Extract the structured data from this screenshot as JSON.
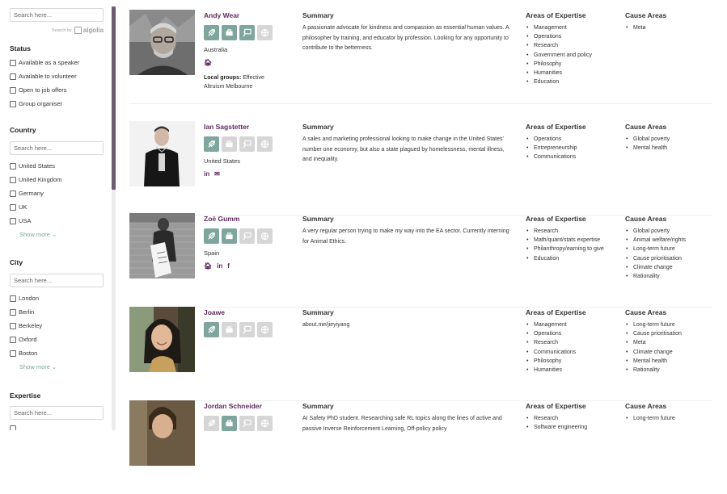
{
  "sidebar": {
    "search_placeholder": "Search here...",
    "search_by": "Search by",
    "algolia": "algolia",
    "status": {
      "heading": "Status",
      "options": [
        "Available as a speaker",
        "Available to volunteer",
        "Open to job offers",
        "Group organiser"
      ]
    },
    "country": {
      "heading": "Country",
      "placeholder": "Search here...",
      "options": [
        "United States",
        "United Kingdom",
        "Germany",
        "UK",
        "USA"
      ],
      "show_more": "Show more"
    },
    "city": {
      "heading": "City",
      "placeholder": "Search here...",
      "options": [
        "London",
        "Berlin",
        "Berkeley",
        "Oxford",
        "Boston"
      ],
      "show_more": "Show more"
    },
    "expertise": {
      "heading": "Expertise",
      "placeholder": "Search here..."
    }
  },
  "headings": {
    "summary": "Summary",
    "expertise": "Areas of Expertise",
    "causes": "Cause Areas"
  },
  "profiles": [
    {
      "name": "Andy Wear",
      "country": "Australia",
      "summary": "A passionate advocate for kindness and compassion as essential human values. A philosopher by training, and educator by profession. Looking for any opportunity to contribute to the betterness.",
      "local_groups_label": "Local groups:",
      "local_groups": "Effective Altruism Melbourne",
      "expertise": [
        "Management",
        "Operations",
        "Research",
        "Government and policy",
        "Philosophy",
        "Humanities",
        "Education"
      ],
      "causes": [
        "Meta"
      ]
    },
    {
      "name": "Ian Sagstetter",
      "country": "United States",
      "summary": "A sales and marketing professional looking to make change in the United States' number one economy, but also a state plagued by homelessness, mental illness, and inequality.",
      "expertise": [
        "Operations",
        "Entrepreneurship",
        "Communications"
      ],
      "causes": [
        "Global poverty",
        "Mental health"
      ]
    },
    {
      "name": "Zoë Gumm",
      "country": "Spain",
      "summary": "A very regular person trying to make my way into the EA sector. Currently interning for Animal Ethics.",
      "expertise": [
        "Research",
        "Math/quant/stats expertise",
        "Philanthropy/earning to give",
        "Education"
      ],
      "causes": [
        "Global poverty",
        "Animal welfare/rights",
        "Long-term future",
        "Cause prioritisation",
        "Climate change",
        "Rationality"
      ]
    },
    {
      "name": "Joawe",
      "country": "",
      "summary": "about.me/jieyiyang",
      "expertise": [
        "Management",
        "Operations",
        "Research",
        "Communications",
        "Philosophy",
        "Humanities"
      ],
      "causes": [
        "Long-term future",
        "Cause prioritisation",
        "Meta",
        "Climate change",
        "Mental health",
        "Rationality"
      ]
    },
    {
      "name": "Jordan Schneider",
      "country": "",
      "summary": "AI Safety PhD student. Researching safe RL topics along the lines of active and passive Inverse Reinforcement Learning, Off-policy policy",
      "expertise": [
        "Research",
        "Software engineering"
      ],
      "causes": [
        "Long-term future"
      ]
    }
  ],
  "colors": {
    "accent": "#5e2a5e",
    "badge_on": "#7ea69c",
    "badge_off": "#d6d6d6",
    "show_more": "#7fa59d"
  }
}
